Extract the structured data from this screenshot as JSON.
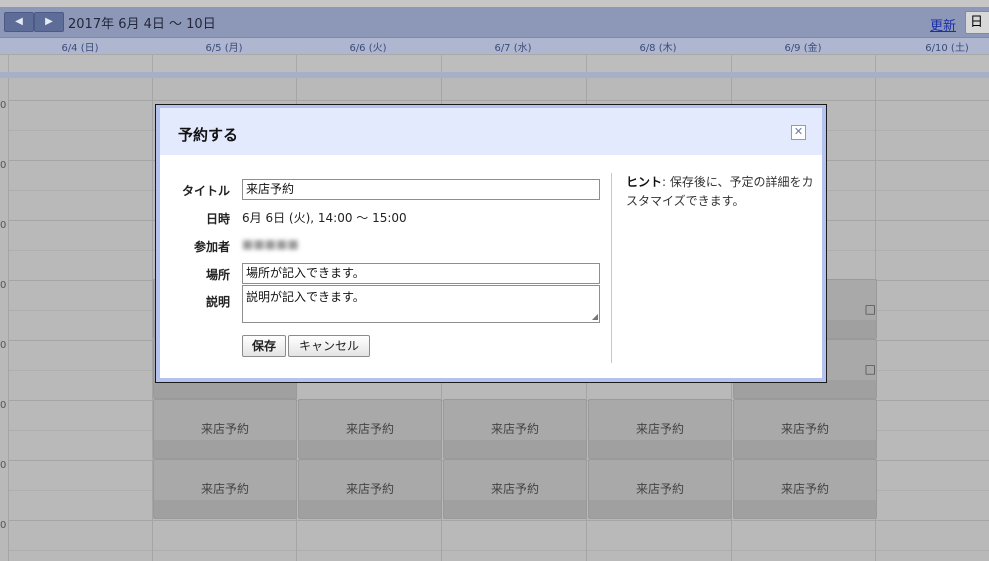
{
  "toolbar": {
    "prev": "◀",
    "next": "▶",
    "date_range": "2017年 6月 4日 ～ 10日",
    "refresh": "更新",
    "view": "日"
  },
  "days": [
    "6/4 (日)",
    "6/5 (月)",
    "6/6 (火)",
    "6/7 (水)",
    "6/8 (木)",
    "6/9 (金)",
    "6/10 (土)"
  ],
  "hour_marks": [
    "0",
    "0",
    "0",
    "0",
    "0",
    "0",
    "0",
    "0"
  ],
  "event_label": "来店予約",
  "peek_glyph": "□",
  "dialog": {
    "title": "予約する",
    "close": "✕",
    "fields": {
      "title_label": "タイトル",
      "title_value": "来店予約",
      "datetime_label": "日時",
      "datetime_value": "6月 6日 (火), 14:00 ～ 15:00",
      "attendees_label": "参加者",
      "location_label": "場所",
      "location_value": "場所が記入できます。",
      "description_label": "説明",
      "description_value": "説明が記入できます。"
    },
    "save": "保存",
    "cancel": "キャンセル",
    "hint_label": "ヒント",
    "hint_text": ": 保存後に、予定の詳細をカスタマイズできます。"
  },
  "colors": {
    "toolbar_bg": "#8d98b8",
    "dialog_border": "#b6c2ee",
    "dialog_header": "#e4eafe"
  }
}
